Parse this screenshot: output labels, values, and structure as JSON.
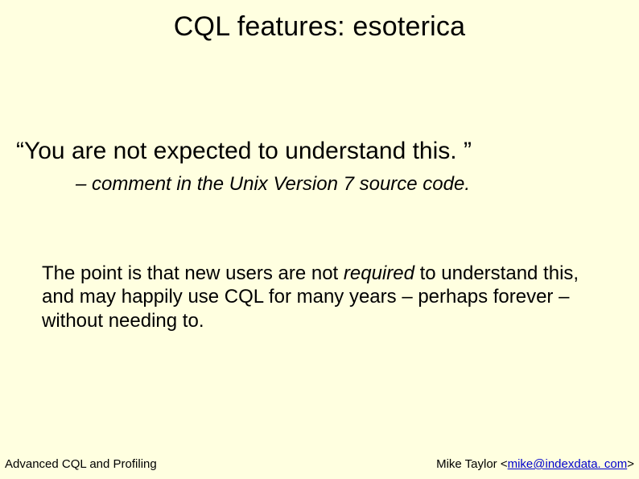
{
  "title": "CQL features: esoterica",
  "quote": "“You are not expected to understand this. ”",
  "attribution": "– comment in the Unix Version 7 source code.",
  "body": {
    "pre": "The point is that new users are not ",
    "em": "required",
    "post": " to understand this, and may happily use CQL for many years – perhaps forever – without needing to."
  },
  "footer": {
    "left": "Advanced CQL and Profiling",
    "right_pre": "Mike Taylor <",
    "email": "mike@indexdata. com",
    "right_post": ">"
  }
}
